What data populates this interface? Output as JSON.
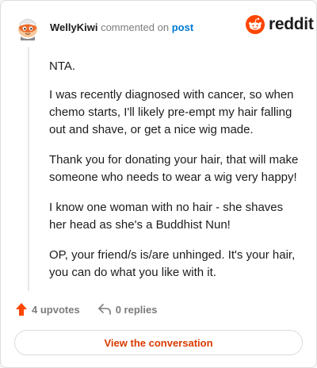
{
  "header": {
    "username": "WellyKiwi",
    "action_text": "commented on",
    "target_link": "post"
  },
  "brand": {
    "name": "reddit",
    "logo_icon": "reddit-alien-icon",
    "accent": "#ff4500"
  },
  "comment": {
    "paragraphs": [
      "NTA.",
      "I was recently diagnosed with cancer, so when chemo starts, I'll likely pre-empt my hair falling out and shave, or get a nice wig made.",
      "Thank you for donating your hair, that will make someone who needs to wear a wig very happy!",
      "I know one woman with no hair - she shaves her head as she's a Buddhist Nun!",
      "OP, your friend/s is/are unhinged. It's your hair, you can do what you like with it."
    ]
  },
  "actions": {
    "upvotes": "4 upvotes",
    "upvote_icon": "upvote-arrow-icon",
    "replies": "0 replies",
    "reply_icon": "reply-arrow-icon"
  },
  "footer": {
    "view_conversation_label": "View the conversation",
    "button_text_color": "#d93a00"
  }
}
